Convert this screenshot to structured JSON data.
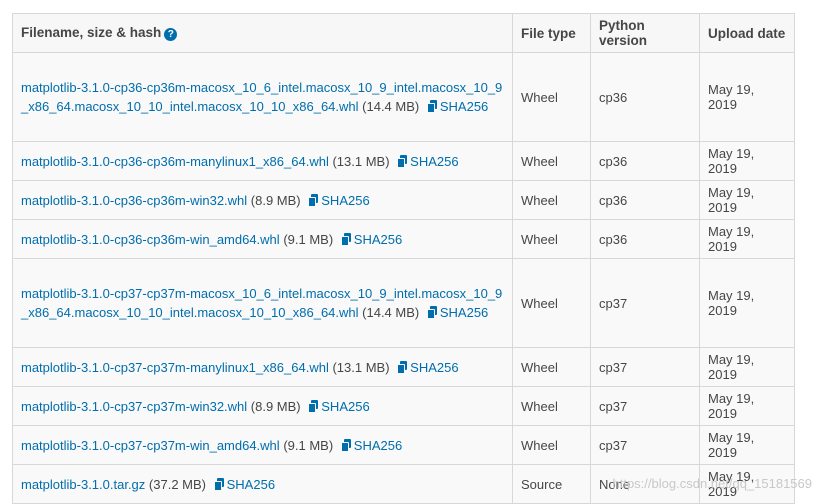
{
  "table": {
    "headers": {
      "filename": "Filename, size & hash",
      "file_type": "File type",
      "python_version": "Python version",
      "upload_date": "Upload date"
    },
    "hash_label": "SHA256",
    "rows": [
      {
        "filename": "matplotlib-3.1.0-cp36-cp36m-macosx_10_6_intel.macosx_10_9_intel.macosx_10_9_x86_64.macosx_10_10_intel.macosx_10_10_x86_64.whl",
        "size": "(14.4 MB)",
        "type": "Wheel",
        "python": "cp36",
        "date": "May 19, 2019"
      },
      {
        "filename": "matplotlib-3.1.0-cp36-cp36m-manylinux1_x86_64.whl",
        "size": "(13.1 MB)",
        "type": "Wheel",
        "python": "cp36",
        "date": "May 19, 2019"
      },
      {
        "filename": "matplotlib-3.1.0-cp36-cp36m-win32.whl",
        "size": "(8.9 MB)",
        "type": "Wheel",
        "python": "cp36",
        "date": "May 19, 2019"
      },
      {
        "filename": "matplotlib-3.1.0-cp36-cp36m-win_amd64.whl",
        "size": "(9.1 MB)",
        "type": "Wheel",
        "python": "cp36",
        "date": "May 19, 2019"
      },
      {
        "filename": "matplotlib-3.1.0-cp37-cp37m-macosx_10_6_intel.macosx_10_9_intel.macosx_10_9_x86_64.macosx_10_10_intel.macosx_10_10_x86_64.whl",
        "size": "(14.4 MB)",
        "type": "Wheel",
        "python": "cp37",
        "date": "May 19, 2019"
      },
      {
        "filename": "matplotlib-3.1.0-cp37-cp37m-manylinux1_x86_64.whl",
        "size": "(13.1 MB)",
        "type": "Wheel",
        "python": "cp37",
        "date": "May 19, 2019"
      },
      {
        "filename": "matplotlib-3.1.0-cp37-cp37m-win32.whl",
        "size": "(8.9 MB)",
        "type": "Wheel",
        "python": "cp37",
        "date": "May 19, 2019"
      },
      {
        "filename": "matplotlib-3.1.0-cp37-cp37m-win_amd64.whl",
        "size": "(9.1 MB)",
        "type": "Wheel",
        "python": "cp37",
        "date": "May 19, 2019"
      },
      {
        "filename": "matplotlib-3.1.0.tar.gz",
        "size": "(37.2 MB)",
        "type": "Source",
        "python": "None",
        "date": "May 19, 2019"
      }
    ]
  },
  "watermark": "https://blog.csdn.net/qq_15181569",
  "colors": {
    "link": "#006dad",
    "text": "#464646",
    "border": "#d8d8d8"
  }
}
